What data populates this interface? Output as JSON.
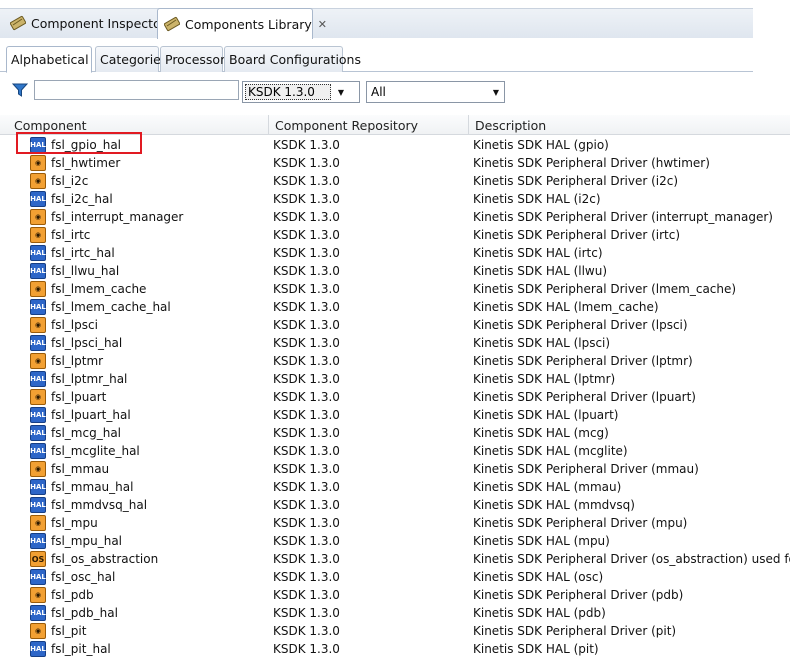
{
  "tabs": {
    "inspector": "Component Inspector",
    "library": "Components Library",
    "close": "✕"
  },
  "subtabs": [
    "Alphabetical",
    "Categories",
    "Processors",
    "Board Configurations"
  ],
  "filter": {
    "search_value": "",
    "sdk_select": "KSDK 1.3.0",
    "category_select": "All"
  },
  "columns": [
    "Component",
    "Component Repository",
    "Description"
  ],
  "rows": [
    {
      "icon": "hal",
      "name": "fsl_gpio_hal",
      "repo": "KSDK 1.3.0",
      "desc": "Kinetis SDK HAL (gpio)"
    },
    {
      "icon": "drv",
      "name": "fsl_hwtimer",
      "repo": "KSDK 1.3.0",
      "desc": "Kinetis SDK Peripheral Driver (hwtimer)"
    },
    {
      "icon": "drv",
      "name": "fsl_i2c",
      "repo": "KSDK 1.3.0",
      "desc": "Kinetis SDK Peripheral Driver (i2c)"
    },
    {
      "icon": "hal",
      "name": "fsl_i2c_hal",
      "repo": "KSDK 1.3.0",
      "desc": "Kinetis SDK HAL (i2c)"
    },
    {
      "icon": "drv",
      "name": "fsl_interrupt_manager",
      "repo": "KSDK 1.3.0",
      "desc": "Kinetis SDK Peripheral Driver (interrupt_manager)"
    },
    {
      "icon": "drv",
      "name": "fsl_irtc",
      "repo": "KSDK 1.3.0",
      "desc": "Kinetis SDK Peripheral Driver (irtc)"
    },
    {
      "icon": "hal",
      "name": "fsl_irtc_hal",
      "repo": "KSDK 1.3.0",
      "desc": "Kinetis SDK HAL (irtc)"
    },
    {
      "icon": "hal",
      "name": "fsl_llwu_hal",
      "repo": "KSDK 1.3.0",
      "desc": "Kinetis SDK HAL (llwu)"
    },
    {
      "icon": "drv",
      "name": "fsl_lmem_cache",
      "repo": "KSDK 1.3.0",
      "desc": "Kinetis SDK Peripheral Driver (lmem_cache)"
    },
    {
      "icon": "hal",
      "name": "fsl_lmem_cache_hal",
      "repo": "KSDK 1.3.0",
      "desc": "Kinetis SDK HAL (lmem_cache)"
    },
    {
      "icon": "drv",
      "name": "fsl_lpsci",
      "repo": "KSDK 1.3.0",
      "desc": "Kinetis SDK Peripheral Driver (lpsci)"
    },
    {
      "icon": "hal",
      "name": "fsl_lpsci_hal",
      "repo": "KSDK 1.3.0",
      "desc": "Kinetis SDK HAL (lpsci)"
    },
    {
      "icon": "drv",
      "name": "fsl_lptmr",
      "repo": "KSDK 1.3.0",
      "desc": "Kinetis SDK Peripheral Driver (lptmr)"
    },
    {
      "icon": "hal",
      "name": "fsl_lptmr_hal",
      "repo": "KSDK 1.3.0",
      "desc": "Kinetis SDK HAL (lptmr)"
    },
    {
      "icon": "drv",
      "name": "fsl_lpuart",
      "repo": "KSDK 1.3.0",
      "desc": "Kinetis SDK Peripheral Driver (lpuart)"
    },
    {
      "icon": "hal",
      "name": "fsl_lpuart_hal",
      "repo": "KSDK 1.3.0",
      "desc": "Kinetis SDK HAL (lpuart)"
    },
    {
      "icon": "hal",
      "name": "fsl_mcg_hal",
      "repo": "KSDK 1.3.0",
      "desc": "Kinetis SDK HAL (mcg)"
    },
    {
      "icon": "hal",
      "name": "fsl_mcglite_hal",
      "repo": "KSDK 1.3.0",
      "desc": "Kinetis SDK HAL (mcglite)"
    },
    {
      "icon": "drv",
      "name": "fsl_mmau",
      "repo": "KSDK 1.3.0",
      "desc": "Kinetis SDK Peripheral Driver (mmau)"
    },
    {
      "icon": "hal",
      "name": "fsl_mmau_hal",
      "repo": "KSDK 1.3.0",
      "desc": "Kinetis SDK HAL (mmau)"
    },
    {
      "icon": "hal",
      "name": "fsl_mmdvsq_hal",
      "repo": "KSDK 1.3.0",
      "desc": "Kinetis SDK HAL (mmdvsq)"
    },
    {
      "icon": "drv",
      "name": "fsl_mpu",
      "repo": "KSDK 1.3.0",
      "desc": "Kinetis SDK Peripheral Driver (mpu)"
    },
    {
      "icon": "hal",
      "name": "fsl_mpu_hal",
      "repo": "KSDK 1.3.0",
      "desc": "Kinetis SDK HAL (mpu)"
    },
    {
      "icon": "osa",
      "name": "fsl_os_abstraction",
      "repo": "KSDK 1.3.0",
      "desc": "Kinetis SDK Peripheral Driver (os_abstraction) used fo"
    },
    {
      "icon": "hal",
      "name": "fsl_osc_hal",
      "repo": "KSDK 1.3.0",
      "desc": "Kinetis SDK HAL (osc)"
    },
    {
      "icon": "drv",
      "name": "fsl_pdb",
      "repo": "KSDK 1.3.0",
      "desc": "Kinetis SDK Peripheral Driver (pdb)"
    },
    {
      "icon": "hal",
      "name": "fsl_pdb_hal",
      "repo": "KSDK 1.3.0",
      "desc": "Kinetis SDK HAL (pdb)"
    },
    {
      "icon": "drv",
      "name": "fsl_pit",
      "repo": "KSDK 1.3.0",
      "desc": "Kinetis SDK Peripheral Driver (pit)"
    },
    {
      "icon": "hal",
      "name": "fsl_pit_hal",
      "repo": "KSDK 1.3.0",
      "desc": "Kinetis SDK HAL (pit)"
    }
  ],
  "icon_labels": {
    "hal": "HAL",
    "drv": "◉",
    "osa": "OS"
  },
  "colors": {
    "highlight": "#e11a22",
    "hal_icon": "#2d66c8",
    "driver_icon": "#f2a033"
  }
}
